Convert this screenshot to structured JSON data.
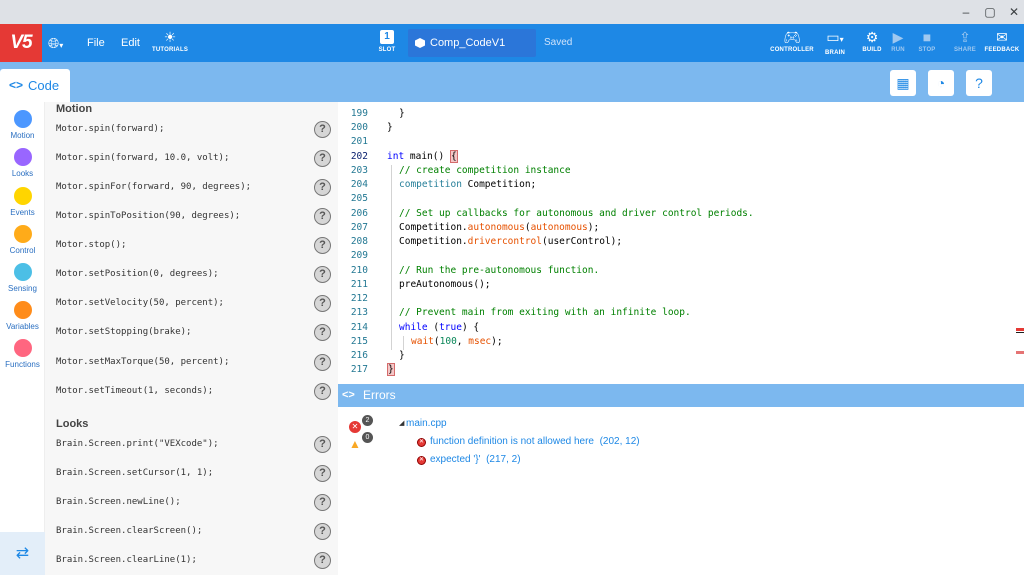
{
  "browser": {
    "minimize": "–",
    "restore": "▢",
    "close": "✕"
  },
  "topbar": {
    "logo": "V5",
    "file_menu": "File",
    "edit_menu": "Edit",
    "tutorials": "TUTORIALS",
    "slot_label": "SLOT",
    "slot_number": "1",
    "project_name": "Comp_CodeV1",
    "save_status": "Saved",
    "controller": "CONTROLLER",
    "brain": "BRAIN",
    "build": "BUILD",
    "run": "RUN",
    "stop": "STOP",
    "share": "SHARE",
    "feedback": "FEEDBACK"
  },
  "tabs": {
    "code_tab": "Code"
  },
  "categories": [
    {
      "name": "Motion",
      "color": "#4c97ff"
    },
    {
      "name": "Looks",
      "color": "#9966ff"
    },
    {
      "name": "Events",
      "color": "#ffd500"
    },
    {
      "name": "Control",
      "color": "#ffab19"
    },
    {
      "name": "Sensing",
      "color": "#4cbfe6"
    },
    {
      "name": "Variables",
      "color": "#ff8c1a"
    },
    {
      "name": "Functions",
      "color": "#ff6680"
    }
  ],
  "palette": {
    "motion_header": "Motion",
    "motion_items": [
      "Motor.spin(forward);",
      "Motor.spin(forward, 10.0, volt);",
      "Motor.spinFor(forward, 90, degrees);",
      "Motor.spinToPosition(90, degrees);",
      "Motor.stop();",
      "Motor.setPosition(0, degrees);",
      "Motor.setVelocity(50, percent);",
      "Motor.setStopping(brake);",
      "Motor.setMaxTorque(50, percent);",
      "Motor.setTimeout(1, seconds);"
    ],
    "looks_header": "Looks",
    "looks_items": [
      "Brain.Screen.print(\"VEXcode\");",
      "Brain.Screen.setCursor(1, 1);",
      "Brain.Screen.newLine();",
      "Brain.Screen.clearScreen();",
      "Brain.Screen.clearLine(1);"
    ],
    "help_glyph": "?"
  },
  "editor": {
    "line_numbers": [
      "199",
      "200",
      "201",
      "202",
      "203",
      "204",
      "205",
      "206",
      "207",
      "208",
      "209",
      "210",
      "211",
      "212",
      "213",
      "214",
      "215",
      "216",
      "217"
    ],
    "current_line": "202",
    "code": {
      "l199": "}",
      "l200": "}",
      "l202_kw": "int",
      "l202_rest": " main() ",
      "l202_brace": "{",
      "l203": "// create competition instance",
      "l204_type": "competition",
      "l204_rest": " Competition;",
      "l206": "// Set up callbacks for autonomous and driver control periods.",
      "l207_a": "Competition.",
      "l207_fn": "autonomous",
      "l207_b": "(",
      "l207_arg": "autonomous",
      "l207_c": ");",
      "l208_a": "Competition.",
      "l208_fn": "drivercontrol",
      "l208_b": "(userControl);",
      "l210": "// Run the pre-autonomous function.",
      "l211": "preAutonomous();",
      "l213": "// Prevent main from exiting with an infinite loop.",
      "l214_kw": "while",
      "l214_a": " (",
      "l214_kw2": "true",
      "l214_b": ") {",
      "l215_fn": "wait",
      "l215_a": "(",
      "l215_num": "100",
      "l215_b": ", ",
      "l215_unit": "msec",
      "l215_c": ");",
      "l216": "}",
      "l217": "}"
    }
  },
  "errors": {
    "title": "Errors",
    "error_count": "2",
    "warning_count": "0",
    "file": "main.cpp",
    "items": [
      {
        "message": "function definition is not allowed here",
        "location": "(202, 12)"
      },
      {
        "message": "expected '}'",
        "location": "(217, 2)"
      }
    ]
  }
}
